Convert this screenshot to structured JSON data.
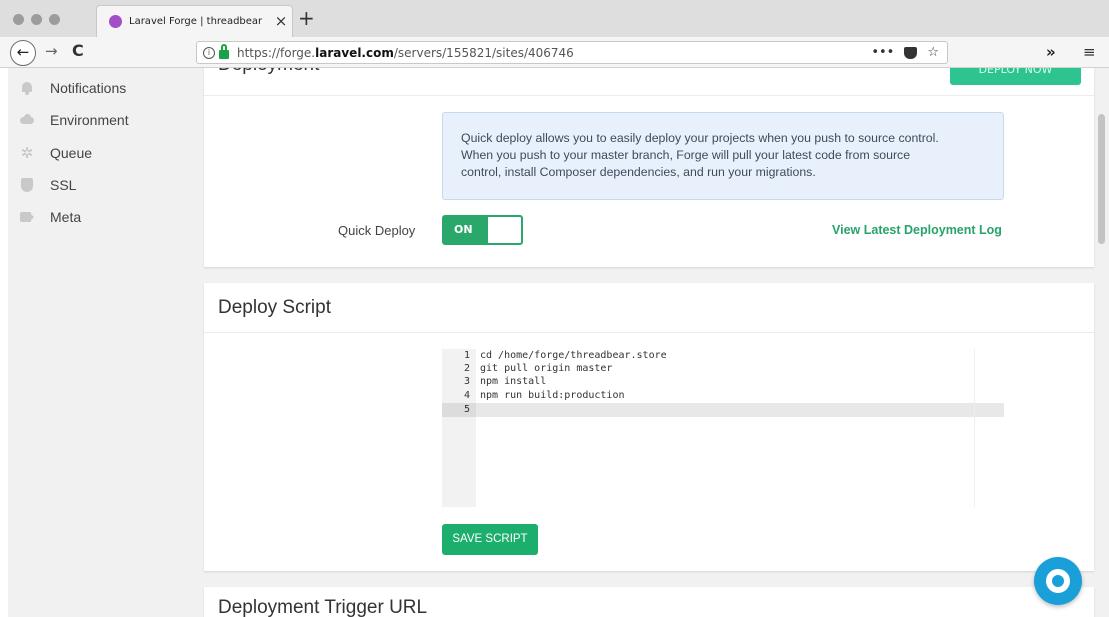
{
  "browser": {
    "tab_title": "Laravel Forge | threadbear",
    "tab_close": "×",
    "new_tab": "+",
    "url_prefix": "https://forge.",
    "url_domain": "laravel.com",
    "url_path": "/servers/155821/sites/406746",
    "more_actions": "•••",
    "bookmark": "☆",
    "overflow": "»",
    "menu": "≡",
    "back": "←",
    "forward": "→",
    "reload": "C"
  },
  "sidebar": {
    "items": [
      {
        "label": "Notifications",
        "icon": "bell-icon"
      },
      {
        "label": "Environment",
        "icon": "cloud-icon"
      },
      {
        "label": "Queue",
        "icon": "gear-icon"
      },
      {
        "label": "SSL",
        "icon": "shield-icon"
      },
      {
        "label": "Meta",
        "icon": "tag-icon"
      }
    ]
  },
  "deployment": {
    "title": "Deployment",
    "deploy_now_label": "DEPLOY NOW",
    "info_lines": [
      "Quick deploy allows you to easily deploy your projects when you push to source control.",
      "When you push to your master branch, Forge will pull your latest code from source",
      "control, install Composer dependencies, and run your migrations."
    ],
    "quick_deploy_label": "Quick Deploy",
    "toggle_state": "ON",
    "log_link": "View Latest Deployment Log"
  },
  "deploy_script": {
    "title": "Deploy Script",
    "lines": [
      {
        "n": "1",
        "text": "cd /home/forge/threadbear.store"
      },
      {
        "n": "2",
        "text": "git pull origin master"
      },
      {
        "n": "3",
        "text": "npm install"
      },
      {
        "n": "4",
        "text": "npm run build:production"
      },
      {
        "n": "5",
        "text": ""
      }
    ],
    "save_label": "SAVE SCRIPT"
  },
  "trigger": {
    "title": "Deployment Trigger URL"
  },
  "colors": {
    "accent_green": "#1cae6d",
    "link_green": "#27a36b",
    "help_blue": "#1a9fd9",
    "info_bg": "#e8f1fb"
  }
}
